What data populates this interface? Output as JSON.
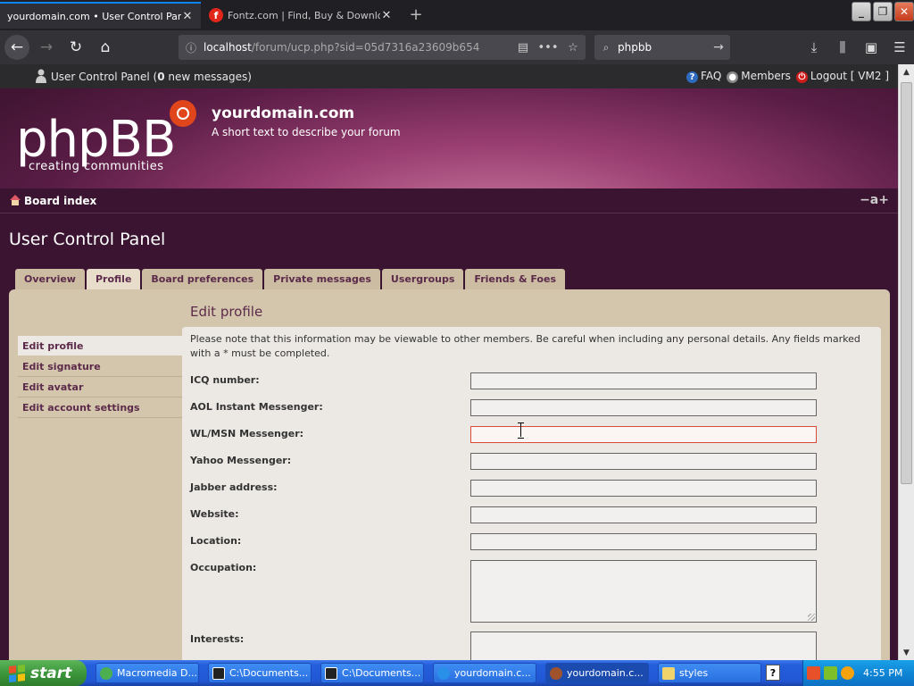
{
  "browser": {
    "tabs": [
      {
        "title": "yourdomain.com • User Control Panel • U",
        "active": true
      },
      {
        "title": "Fontz.com | Find, Buy & Download",
        "active": false
      }
    ],
    "url_host": "localhost",
    "url_path": "/forum/ucp.php?sid=05d7316a23609b654",
    "search_text": "phpbb",
    "icons": [
      "back-icon",
      "forward-icon",
      "reload-icon",
      "home-icon",
      "info-icon",
      "reader-icon",
      "more-icon",
      "bookmark-star-icon",
      "search-icon",
      "go-arrow-icon",
      "download-icon",
      "library-icon",
      "sidebar-icon",
      "menu-icon"
    ]
  },
  "forum": {
    "top": {
      "ucp_label": "User Control Panel",
      "messages_count": "0",
      "messages_suffix": "new messages",
      "faq": "FAQ",
      "members": "Members",
      "logout": "Logout [ VM2 ]"
    },
    "logo_big": "phpBB",
    "logo_small": "creating   communities",
    "site_name": "yourdomain.com",
    "site_desc": "A short text to describe your forum",
    "breadcrumb": "Board index",
    "fontsize_icon": "−a+",
    "page_title": "User Control Panel",
    "tabs": [
      "Overview",
      "Profile",
      "Board preferences",
      "Private messages",
      "Usergroups",
      "Friends & Foes"
    ],
    "active_tab": "Profile",
    "subnav": [
      "Edit profile",
      "Edit signature",
      "Edit avatar",
      "Edit account settings"
    ],
    "active_subnav": "Edit profile",
    "section_title": "Edit profile",
    "notice": "Please note that this information may be viewable to other members. Be careful when including any personal details. Any fields marked with a * must be completed.",
    "fields": [
      {
        "label": "ICQ number:",
        "value": ""
      },
      {
        "label": "AOL Instant Messenger:",
        "value": ""
      },
      {
        "label": "WL/MSN Messenger:",
        "value": "",
        "focused": true
      },
      {
        "label": "Yahoo Messenger:",
        "value": ""
      },
      {
        "label": "Jabber address:",
        "value": ""
      },
      {
        "label": "Website:",
        "value": ""
      },
      {
        "label": "Location:",
        "value": ""
      },
      {
        "label": "Occupation:",
        "value": "",
        "multiline": true
      },
      {
        "label": "Interests:",
        "value": "",
        "multiline": true
      }
    ]
  },
  "taskbar": {
    "start": "start",
    "items": [
      "Macromedia D...",
      "C:\\Documents...",
      "C:\\Documents...",
      "yourdomain.c...",
      "yourdomain.c...",
      "styles"
    ],
    "active_item_index": 4,
    "clock": "4:55 PM"
  },
  "colors": {
    "accent_tab": "#0a84ff",
    "banner": "#9a3e71",
    "link_purple": "#5c2a4a",
    "panel_tan": "#d4c6ad",
    "focus_border": "#d84a3a",
    "xp_start_green": "#3c963b",
    "xp_taskbar_blue": "#245edb"
  }
}
